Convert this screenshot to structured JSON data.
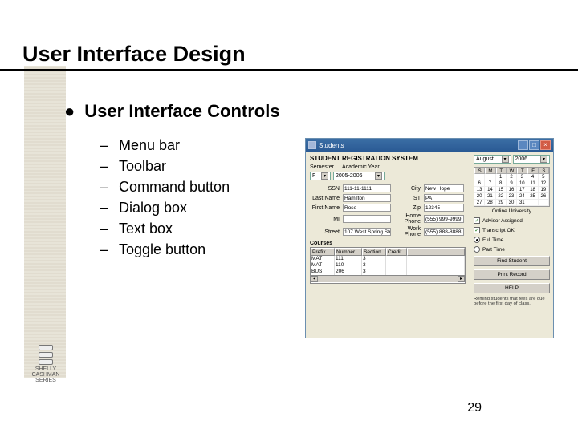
{
  "slide": {
    "title": "User Interface Design",
    "main_bullet": "User Interface Controls",
    "sub_items": [
      "Menu bar",
      "Toolbar",
      "Command button",
      "Dialog box",
      "Text box",
      "Toggle button"
    ],
    "page_number": "29",
    "series_logo": "SHELLY CASHMAN SERIES"
  },
  "app": {
    "window_title": "Students",
    "header": "STUDENT REGISTRATION SYSTEM",
    "sem_labels": {
      "semester": "Semester",
      "year": "Academic Year"
    },
    "sem_values": {
      "semester": "F",
      "year": "2005-2006"
    },
    "fields": {
      "ssn_lbl": "SSN",
      "ssn": "111-11-1111",
      "lastname_lbl": "Last Name",
      "lastname": "Hamilton",
      "firstname_lbl": "First Name",
      "firstname": "Rose",
      "mi_lbl": "MI",
      "mi": "",
      "city_lbl": "City",
      "city": "New Hope",
      "st_lbl": "ST",
      "st": "PA",
      "zip_lbl": "Zip",
      "zip": "12345",
      "homeph_lbl": "Home Phone",
      "homephone": "(555) 999-9999",
      "workph_lbl": "Work Phone",
      "workphone": "(555) 888-8888",
      "street_lbl": "Street",
      "street": "107 West Spring Street"
    },
    "courses": {
      "label": "Courses",
      "headers": [
        "Prefix",
        "Number",
        "Section",
        "Credit",
        ""
      ],
      "rows": [
        [
          "MAT",
          "111",
          "3",
          "",
          ""
        ],
        [
          "MAT",
          "110",
          "3",
          "",
          ""
        ],
        [
          "BUS",
          "206",
          "3",
          "",
          ""
        ]
      ]
    },
    "calendar": {
      "month": "August",
      "year": "2006",
      "uni_label": "Online University",
      "day_headers": [
        "S",
        "M",
        "T",
        "W",
        "T",
        "F",
        "S"
      ],
      "cells": [
        "",
        "",
        "1",
        "2",
        "3",
        "4",
        "5",
        "6",
        "7",
        "8",
        "9",
        "10",
        "11",
        "12",
        "13",
        "14",
        "15",
        "16",
        "17",
        "18",
        "19",
        "20",
        "21",
        "22",
        "23",
        "24",
        "25",
        "26",
        "27",
        "28",
        "29",
        "30",
        "31",
        "",
        ""
      ]
    },
    "checks": {
      "advisor": "Advisor Assigned",
      "transcript": "Transcript OK"
    },
    "radios": {
      "fulltime": "Full Time",
      "parttime": "Part Time"
    },
    "buttons": {
      "find": "Find Student",
      "print": "Print Record",
      "help": "HELP"
    },
    "note": "Remind students that fees are due before the first day of class."
  }
}
